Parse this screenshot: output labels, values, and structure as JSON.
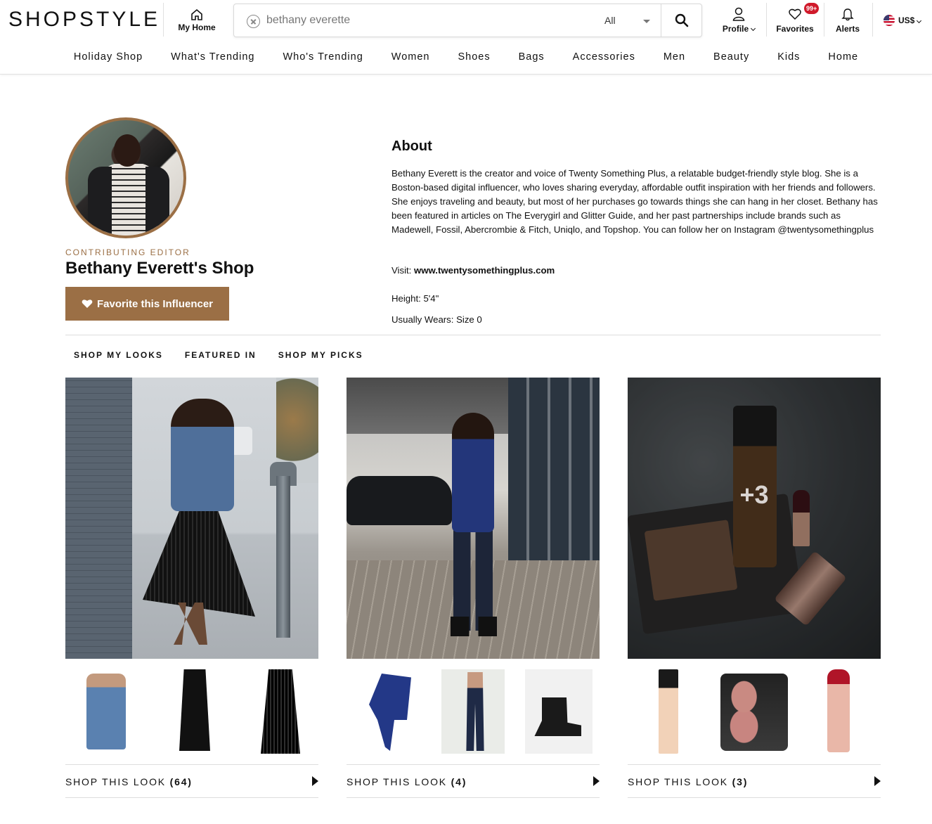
{
  "header": {
    "logo": "SHOPSTYLE",
    "my_home": "My Home",
    "search": {
      "value": "bethany everette",
      "category": "All"
    },
    "profile": "Profile",
    "favorites": "Favorites",
    "favorites_badge": "99+",
    "alerts": "Alerts",
    "currency": "US$",
    "colors": {
      "accent": "#9b6f45",
      "badge": "#d01a2b"
    }
  },
  "nav": [
    "Holiday Shop",
    "What's Trending",
    "Who's Trending",
    "Women",
    "Shoes",
    "Bags",
    "Accessories",
    "Men",
    "Beauty",
    "Kids",
    "Home"
  ],
  "profile": {
    "role": "CONTRIBUTING EDITOR",
    "shop_name": "Bethany Everett's Shop",
    "favorite_button": "Favorite this Influencer"
  },
  "about": {
    "title": "About",
    "text": "Bethany Everett is the creator and voice of Twenty Something Plus, a relatable budget-friendly style blog. She is a Boston-based digital influencer, who loves sharing everyday, affordable outfit inspiration with her friends and followers. She enjoys traveling and beauty, but most of her purchases go towards things she can hang in her closet. Bethany has been featured in articles on The Everygirl and Glitter Guide, and her past partnerships include brands such as Madewell, Fossil, Abercrombie & Fitch, Uniqlo, and Topshop. You can follow her on Instagram @twentysomethingplus",
    "visit_label": "Visit:",
    "visit_url": "www.twentysomethingplus.com",
    "height": "Height: 5'4\"",
    "wears": "Usually Wears: Size 0"
  },
  "tabs": [
    "SHOP MY LOOKS",
    "FEATURED IN",
    "SHOP MY PICKS"
  ],
  "looks": [
    {
      "label": "SHOP THIS LOOK",
      "count": "(64)"
    },
    {
      "label": "SHOP THIS LOOK",
      "count": "(4)"
    },
    {
      "label": "SHOP THIS LOOK",
      "count": "(3)",
      "overlay": "+3"
    }
  ]
}
